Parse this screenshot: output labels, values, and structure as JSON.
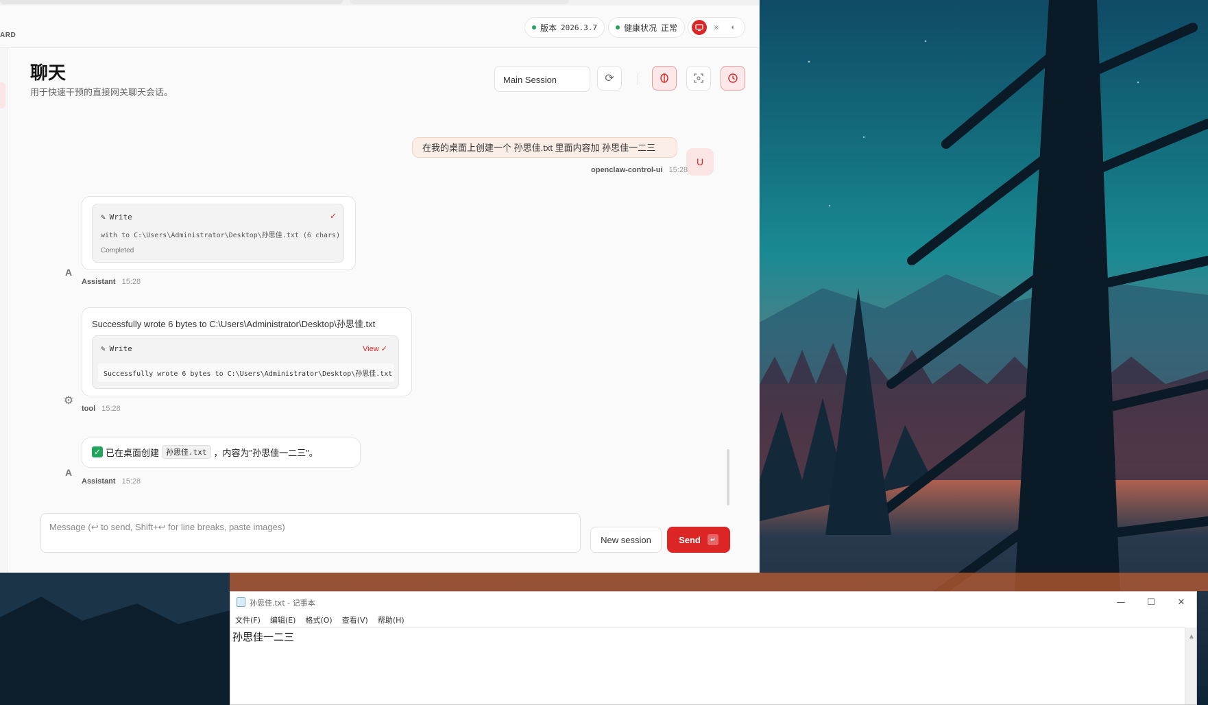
{
  "app": {
    "brand": "ARD",
    "version_label": "版本",
    "version_value": "2026.3.7",
    "health_label": "健康状况",
    "health_value": "正常",
    "page_title": "聊天",
    "page_subtitle": "用于快速干预的直接网关聊天会话。",
    "session_select": "Main Session"
  },
  "chat": {
    "user_message": "在我的桌面上创建一个 孙思佳.txt 里面内容加 孙思佳一二三",
    "user_avatar": "U",
    "user_sender": "openclaw-control-ui",
    "user_time": "15:28",
    "msg1": {
      "avatar": "A",
      "tool_name": "Write",
      "tool_args": "with to C:\\Users\\Administrator\\Desktop\\孙思佳.txt (6 chars)",
      "tool_status": "Completed",
      "sender": "Assistant",
      "time": "15:28"
    },
    "msg2": {
      "avatar": "⚙",
      "result_text": "Successfully wrote 6 bytes to C:\\Users\\Administrator\\Desktop\\孙思佳.txt",
      "tool_name": "Write",
      "view_label": "View",
      "code_output": "Successfully wrote 6 bytes to C:\\Users\\Administrator\\Desktop\\孙思佳.txt",
      "sender": "tool",
      "time": "15:28"
    },
    "msg3": {
      "avatar": "A",
      "text_before": "已在桌面创建",
      "file_chip": "孙思佳.txt",
      "text_after": "，内容为\"孙思佳一二三\"。",
      "sender": "Assistant",
      "time": "15:28"
    }
  },
  "composer": {
    "placeholder": "Message (↩ to send, Shift+↩ for line breaks, paste images)",
    "new_session_label": "New session",
    "send_label": "Send"
  },
  "notepad": {
    "title": "孙思佳.txt - 记事本",
    "menu": [
      "文件(F)",
      "编辑(E)",
      "格式(O)",
      "查看(V)",
      "帮助(H)"
    ],
    "content": "孙思佳一二三"
  },
  "colors": {
    "accent": "#dc2626",
    "status_green": "#22a45d"
  }
}
